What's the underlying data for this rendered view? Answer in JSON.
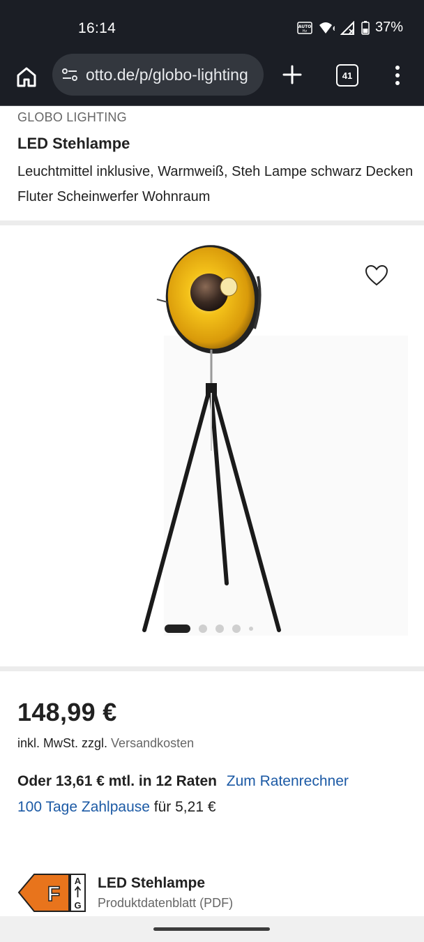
{
  "status_bar": {
    "time": "16:14",
    "battery": "37%",
    "icons": [
      "auto-hz-icon",
      "wifi-6-icon",
      "signal-icon",
      "battery-icon"
    ]
  },
  "browser": {
    "url": "otto.de/p/globo-lighting",
    "tab_count": "41",
    "icons": [
      "home-icon",
      "site-settings-icon",
      "plus-icon",
      "tabs-icon",
      "more-vert-icon"
    ]
  },
  "product": {
    "brand": "GLOBO LIGHTING",
    "title": "LED Stehlampe",
    "subtitle": "Leuchtmittel inklusive, Warmweiß, Steh Lampe schwarz Decken Fluter Scheinwerfer Wohnraum"
  },
  "gallery": {
    "image_count": 5,
    "active_index": 0,
    "favorite_icon": "heart-outline-icon"
  },
  "pricing": {
    "price": "148,99 €",
    "vat_prefix": "inkl. MwSt. zzgl.",
    "shipping_link": "Versandkosten",
    "installment_text": "Oder 13,61 € mtl. in 12 Raten",
    "installment_link": "Zum Ratenrechner",
    "pause_link": "100 Tage Zahlpause",
    "pause_suffix": "für 5,21 €"
  },
  "energy_label": {
    "class": "F",
    "scale_top": "A",
    "scale_bottom": "G",
    "title": "LED Stehlampe",
    "subtitle": "Produktdatenblatt (PDF)",
    "color": "#e8741c"
  }
}
